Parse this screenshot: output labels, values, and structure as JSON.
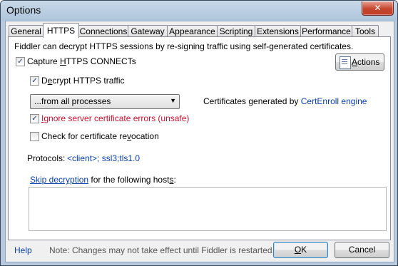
{
  "window": {
    "title": "Options",
    "close_glyph": "✕"
  },
  "tabs": [
    {
      "label": "General"
    },
    {
      "label": "HTTPS"
    },
    {
      "label": "Connections"
    },
    {
      "label": "Gateway"
    },
    {
      "label": "Appearance"
    },
    {
      "label": "Scripting"
    },
    {
      "label": "Extensions"
    },
    {
      "label": "Performance"
    },
    {
      "label": "Tools"
    }
  ],
  "active_tab": "HTTPS",
  "https": {
    "intro": "Fiddler can decrypt HTTPS sessions by re-signing traffic using self-generated certificates.",
    "capture": {
      "label_pre": "Capture ",
      "label_ul": "H",
      "label_post": "TTPS CONNECTs",
      "checked": true
    },
    "actions_button": {
      "label_ul": "A",
      "label_post": "ctions",
      "icon": "certificate-icon"
    },
    "decrypt": {
      "label_pre": "D",
      "label_ul": "e",
      "label_post": "crypt HTTPS traffic",
      "checked": true
    },
    "process_filter": {
      "selected": "...from all processes",
      "arrow": "▼"
    },
    "cert_info": {
      "prefix": "Certificates generated by ",
      "engine": "CertEnroll engine"
    },
    "ignore_errors": {
      "label_ul": "I",
      "label_post": "gnore server certificate errors (unsafe)",
      "checked": true
    },
    "revocation": {
      "label_pre": "Check for certificate re",
      "label_ul": "v",
      "label_post": "ocation",
      "checked": false
    },
    "protocols": {
      "label": "Protocols: ",
      "value": "<client>; ssl3;tls1.0"
    },
    "skip": {
      "link": "Skip decryption",
      "text_pre": " for the following host",
      "text_ul": "s",
      "text_post": ":"
    },
    "hosts_value": ""
  },
  "footer": {
    "help": "Help",
    "note": "Note: Changes may not take effect until Fiddler is restarted.",
    "ok_ul": "O",
    "ok_post": "K",
    "cancel": "Cancel"
  },
  "colors": {
    "link": "#0b3fa6",
    "warning_red": "#c8102e",
    "title_bar": "#b7c9dc",
    "close_button": "#c5452e"
  }
}
